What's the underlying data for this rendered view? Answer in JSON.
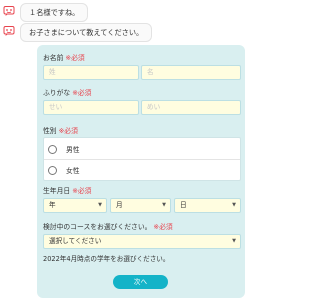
{
  "chat": {
    "messages": [
      "１名様ですね。",
      "お子さまについて教えてください。"
    ]
  },
  "form": {
    "name": {
      "label": "お名前",
      "required": "※必須",
      "last_placeholder": "姓",
      "first_placeholder": "名"
    },
    "kana": {
      "label": "ふりがな",
      "required": "※必須",
      "last_placeholder": "せい",
      "first_placeholder": "めい"
    },
    "gender": {
      "label": "性別",
      "required": "※必須",
      "options": [
        "男性",
        "女性"
      ]
    },
    "birthday": {
      "label": "生年月日",
      "required": "※必須",
      "year": "年",
      "month": "月",
      "day": "日"
    },
    "course": {
      "label": "検討中のコースをお選びください。",
      "required": "※必須",
      "placeholder": "選択してください"
    },
    "note": "2022年4月時点の学年をお選びください。",
    "next_button": "次へ"
  },
  "colors": {
    "accent": "#14b3c8",
    "panel": "#d9eff0",
    "required": "#e8434d",
    "input_bg": "#fffde0",
    "bot_icon": "#e8434d"
  }
}
